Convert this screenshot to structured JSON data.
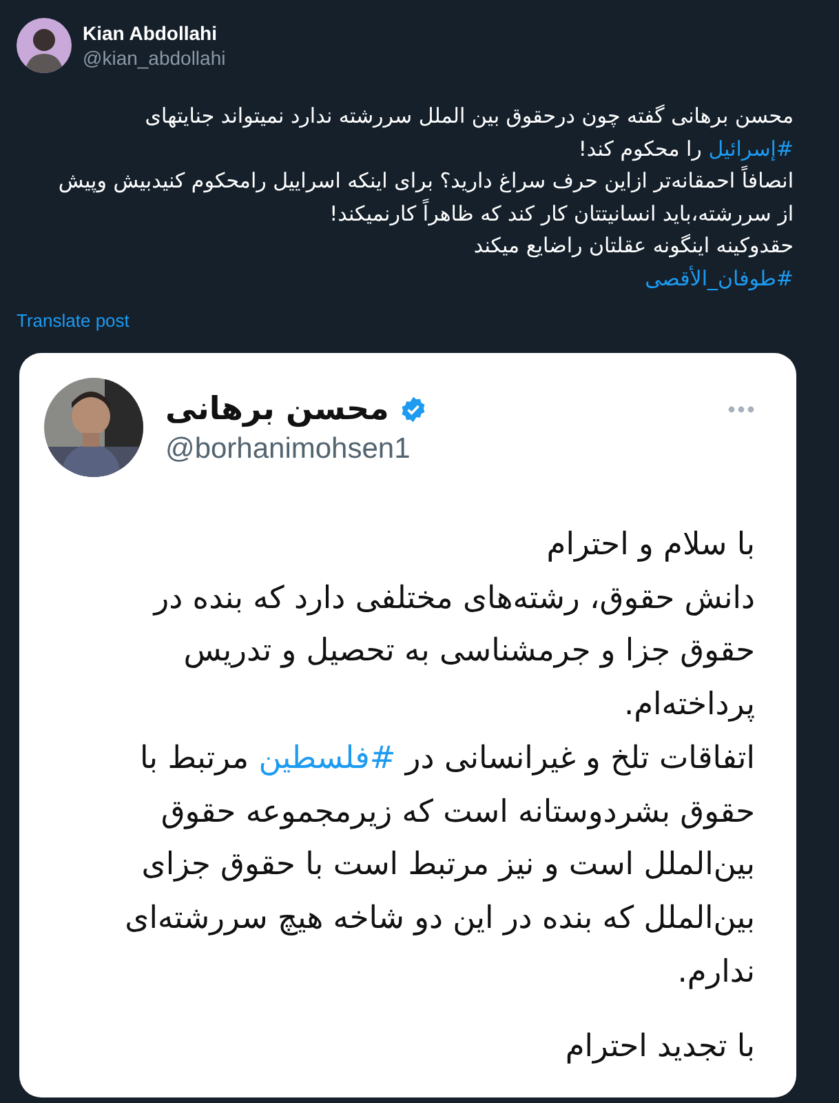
{
  "author": {
    "name": "Kian Abdollahi",
    "handle": "@kian_abdollahi"
  },
  "post_lines": [
    {
      "segments": [
        {
          "kind": "text",
          "text": "محسن برهانی گفته چون درحقوق بین الملل سررشته ندارد نمیتواند جنایتهای"
        }
      ]
    },
    {
      "segments": [
        {
          "kind": "hashtag",
          "text": "#إسرائیل"
        },
        {
          "kind": "text",
          "text": " را محکوم کند!"
        }
      ]
    },
    {
      "segments": [
        {
          "kind": "text",
          "text": "انصافاً احمقانه‌تر ازاین حرف سراغ دارید؟ برای اینکه اسراییل رامحکوم کنیدبیش وپیش"
        }
      ]
    },
    {
      "segments": [
        {
          "kind": "text",
          "text": "از سررشته،باید انسانیتتان کار کند که ظاهراً کارنمیکند!"
        }
      ]
    },
    {
      "segments": [
        {
          "kind": "text",
          "text": "حقدوکینه اینگونه عقلتان راضایع میکند"
        }
      ]
    },
    {
      "segments": [
        {
          "kind": "hashtag",
          "text": "#طوفان_الأقصى"
        }
      ]
    }
  ],
  "translate_link": "Translate post",
  "quoted": {
    "name": "محسن برهانی",
    "verified": true,
    "handle": "@borhanimohsen1",
    "paragraphs": [
      {
        "lines": [
          {
            "segments": [
              {
                "kind": "text",
                "text": "با سلام و احترام"
              }
            ]
          },
          {
            "segments": [
              {
                "kind": "text",
                "text": "دانش حقوق، رشته‌های مختلفی دارد که بنده در"
              }
            ]
          },
          {
            "segments": [
              {
                "kind": "text",
                "text": "حقوق جزا و جرمشناسی به تحصیل و تدریس"
              }
            ]
          },
          {
            "segments": [
              {
                "kind": "text",
                "text": "پرداخته‌ام."
              }
            ]
          },
          {
            "segments": [
              {
                "kind": "text",
                "text": "اتفاقات تلخ و غیرانسانی در "
              },
              {
                "kind": "hashtag",
                "text": "#فلسطین"
              },
              {
                "kind": "text",
                "text": " مرتبط با"
              }
            ]
          },
          {
            "segments": [
              {
                "kind": "text",
                "text": "حقوق بشردوستانه است که زیرمجموعه حقوق"
              }
            ]
          },
          {
            "segments": [
              {
                "kind": "text",
                "text": "بین‌الملل است و نیز مرتبط است با حقوق جزای"
              }
            ]
          },
          {
            "segments": [
              {
                "kind": "text",
                "text": "بین‌الملل که بنده در این دو شاخه هیچ سررشته‌ای"
              }
            ]
          },
          {
            "segments": [
              {
                "kind": "text",
                "text": "ندارم."
              }
            ]
          }
        ]
      },
      {
        "lines": [
          {
            "segments": [
              {
                "kind": "text",
                "text": "با تجدید احترام"
              }
            ]
          }
        ]
      }
    ]
  }
}
